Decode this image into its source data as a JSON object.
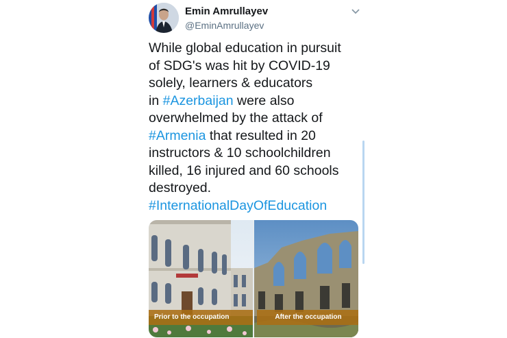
{
  "author": {
    "name": "Emin Amrullayev",
    "handle": "@EminAmrullayev"
  },
  "icons": {
    "menu": "chevron-down-icon",
    "avatar": "avatar"
  },
  "tweet": {
    "lines": [
      "While global education in pursuit",
      "of SDG's was hit by COVID-19",
      "solely, learners & educators"
    ],
    "line4_prefix": "in ",
    "hashtag_azerbaijan": "#Azerbaijan",
    "line4_suffix": " were also",
    "line5": "overwhelmed by the attack of",
    "hashtag_armenia": "#Armenia",
    "line6_suffix": " that resulted in 20",
    "line7": "instructors & 10 schoolchildren",
    "line8": "killed, 16 injured and 60 schools",
    "line9": "destroyed.",
    "hashtag_education_day": "#InternationalDayOfEducation"
  },
  "media": {
    "left_caption": "Prior to the occupation",
    "right_caption": "After the occupation"
  },
  "colors": {
    "hashtag": "#1b95e0",
    "caption_bg": "#aa6e14",
    "handle": "#5b7083"
  }
}
